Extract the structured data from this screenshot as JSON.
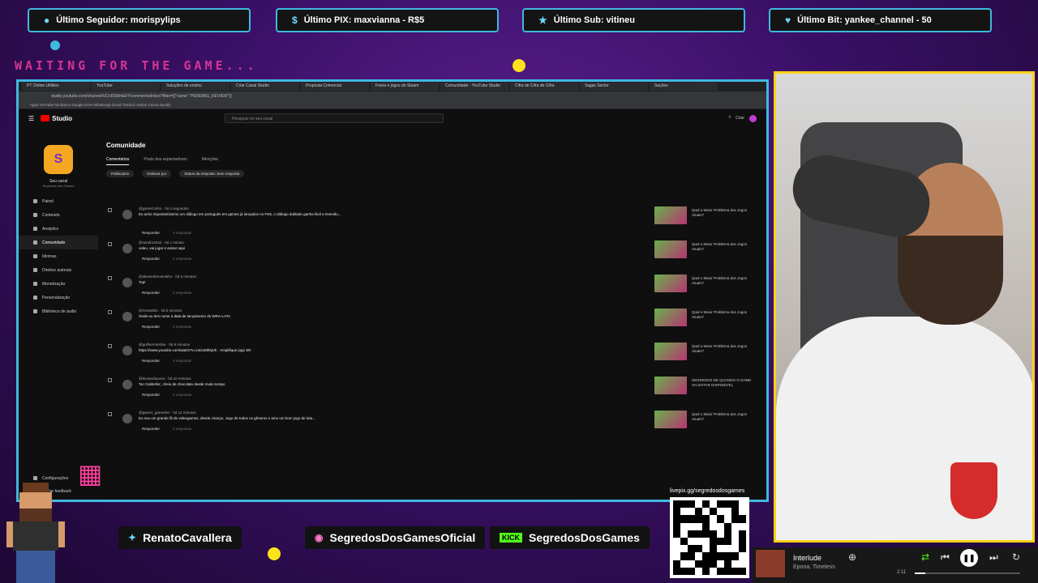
{
  "overlay": {
    "waiting_text": "WAITING FOR THE GAME...",
    "alerts": [
      {
        "icon": "user-icon",
        "text": "Último Seguidor: morispylips"
      },
      {
        "icon": "dollar-icon",
        "text": "Último PIX: maxvianna - R$5"
      },
      {
        "icon": "star-icon",
        "text": "Último Sub: vitineu"
      },
      {
        "icon": "diamond-icon",
        "text": "Último Bit: yankee_channel - 50"
      }
    ],
    "socials": [
      {
        "icon": "twitter-icon",
        "text": "RenatoCavallera"
      },
      {
        "icon": "instagram-icon",
        "text": "SegredosDosGamesOficial"
      },
      {
        "icon": "kick-icon",
        "badge": "KICK",
        "text": "SegredosDosGames"
      }
    ],
    "qr_label": "livepix.gg/segredosdosgames",
    "accent": "#3fb8e0",
    "webcam_border": "#ffd21a"
  },
  "browser": {
    "tabs": [
      "PT Online Utilities",
      "YouTube",
      "Soluções de ensino",
      "Criar Canal Studio",
      "Proposta Comercial",
      "Freira e jogos do Steam",
      "Comunidade - YouTube Studio",
      "Cifra de Cifra de Cifra",
      "Vagas Sector",
      "Seções"
    ],
    "address": "studio.youtube.com/channel/UCnD5i8mEkY/comments/inbox?filter=[{\"name\":\"PENDING_REVIEW\"}]",
    "bookmarks": "Apps  YouTube  Nu Banco  Google Drive  WhatsApp  Gmail  Traduzir  Notion  Canva  Spotify"
  },
  "studio": {
    "logo": "Studio",
    "search_placeholder": "Pesquise no seu canal",
    "create_label": "Criar",
    "channel_name": "Seu canal",
    "channel_sub": "Segredos dos Games",
    "nav": [
      {
        "icon": "dashboard-icon",
        "label": "Painel"
      },
      {
        "icon": "content-icon",
        "label": "Conteúdo"
      },
      {
        "icon": "analytics-icon",
        "label": "Analytics"
      },
      {
        "icon": "community-icon",
        "label": "Comunidade"
      },
      {
        "icon": "subtitles-icon",
        "label": "Idiomas"
      },
      {
        "icon": "copyright-icon",
        "label": "Direitos autorais"
      },
      {
        "icon": "monetization-icon",
        "label": "Monetização"
      },
      {
        "icon": "customize-icon",
        "label": "Personalização"
      },
      {
        "icon": "audio-icon",
        "label": "Biblioteca de áudio"
      }
    ],
    "settings_label": "Configurações",
    "feedback_label": "Enviar feedback",
    "page_title": "Comunidade",
    "subtabs": [
      "Comentários",
      "Posts dos espectadores",
      "Menções"
    ],
    "filters": [
      "Publicados",
      "Ordenar por",
      "Status da resposta: Sem resposta"
    ],
    "reply_label": "Responder",
    "replies_label": "0 respostas",
    "comments": [
      {
        "author": "@gamerzinho · há 4 segundos",
        "text": "Eu acho importantíssimo um diálogo em português em games já lançados no PS5, o diálogo dublado ganha fácil a imersão...",
        "video": "Qual o Maior Problema dos Jogos Atuais?"
      },
      {
        "author": "@sandro2342 · há 1 minuto",
        "text": "valeu, vai jogar e avisar aqui",
        "video": "Qual o Maior Problema dos Jogos Atuais?"
      },
      {
        "author": "@alexandrecarvalho · há 2 minutos",
        "text": "Top!",
        "video": "Qual o Maior Problema dos Jogos Atuais?"
      },
      {
        "author": "@renatofan · há 5 minutos",
        "text": "Onde eu tem nome a data de lançamento do WRA-LATA",
        "video": "Qual o Maior Problema dos Jogos Atuais?"
      },
      {
        "author": "@guilhermesilva · há 8 minutos",
        "text": "https://www.youtube.com/watch?v=z4dJ48f0qVk · Amplifique jogo SR",
        "video": "Qual o Maior Problema dos Jogos Atuais?"
      },
      {
        "author": "@leonardoporto · há 10 minutos",
        "text": "'No Calderão', cheio de chocolate desde muito tempo",
        "video": "SEGREDOS DE QUANDO O GAME VAI ESTAR DISPONÍVEL"
      },
      {
        "author": "@gamer_gamedev · há 12 minutos",
        "text": "Eu sou um grande fã de videogames, desde criança. Jogo de todos os gêneros e amo um bom jogo de luta...",
        "video": "Qual o Maior Problema dos Jogos Atuais?"
      }
    ]
  },
  "player": {
    "title": "Interlude",
    "artist": "Epona, Timeless",
    "time": "2:11",
    "progress": 0.1
  }
}
